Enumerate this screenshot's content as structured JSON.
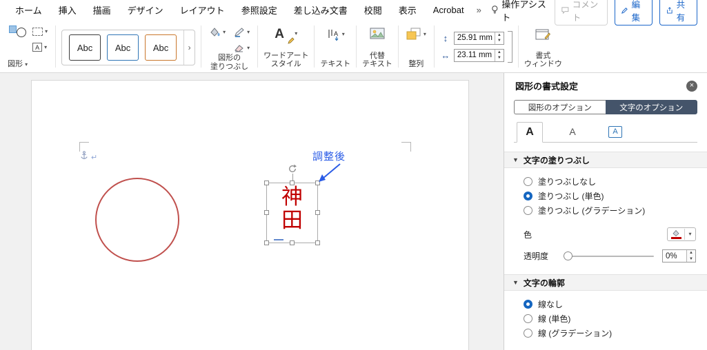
{
  "menubar": {
    "items": [
      "ホーム",
      "挿入",
      "描画",
      "デザイン",
      "レイアウト",
      "参照設定",
      "差し込み文書",
      "校閲",
      "表示",
      "Acrobat",
      "»"
    ],
    "assistant_label": "操作アシスト",
    "comment_label": "コメント",
    "edit_label": "編集",
    "share_label": "共有"
  },
  "ribbon": {
    "shapes": {
      "label": "図形"
    },
    "style_gallery": {
      "cell1": "Abc",
      "cell2": "Abc",
      "cell3": "Abc",
      "more": "›"
    },
    "shape_fill": {
      "label_line1": "図形の",
      "label_line2": "塗りつぶし"
    },
    "wordart": {
      "label_line1": "ワードアート",
      "label_line2": "スタイル",
      "letter": "A"
    },
    "text_group": {
      "label": "テキスト"
    },
    "alt_text": {
      "label_line1": "代替",
      "label_line2": "テキスト"
    },
    "arrange": {
      "label": "整列"
    },
    "size": {
      "height_value": "25.91 mm",
      "width_value": "23.11 mm",
      "height_icon": "↕",
      "width_icon": "↔"
    },
    "format_window": {
      "label_line1": "書式",
      "label_line2": "ウィンドウ"
    }
  },
  "document": {
    "annotation_label": "調整後",
    "textbox_char1": "神",
    "textbox_char2": "田",
    "return_mark": "↵"
  },
  "panel": {
    "title": "図形の書式設定",
    "close_glyph": "×",
    "tab_shape_options": "図形のオプション",
    "tab_text_options": "文字のオプション",
    "selected_tab": "文字のオプション",
    "icon_tab1": "A",
    "icon_tab2": "A",
    "icon_tab3": "A",
    "fill_section": {
      "title": "文字の塗りつぶし",
      "option_none": "塗りつぶしなし",
      "option_solid": "塗りつぶし (単色)",
      "option_gradient": "塗りつぶし (グラデーション)",
      "selected": "塗りつぶし (単色)",
      "color_label": "色",
      "transparency_label": "透明度",
      "transparency_value": "0%"
    },
    "outline_section": {
      "title": "文字の輪郭",
      "option_none": "線なし",
      "option_solid": "線 (単色)",
      "option_gradient": "線 (グラデーション)",
      "selected": "線なし"
    }
  },
  "colors": {
    "accent_blue": "#1b66c9",
    "annotation_blue": "#2b5ce6",
    "text_red": "#c00000",
    "circle_red": "#c0504d",
    "selected_segment_bg": "#44546a",
    "radio_selected": "#1566c0"
  }
}
